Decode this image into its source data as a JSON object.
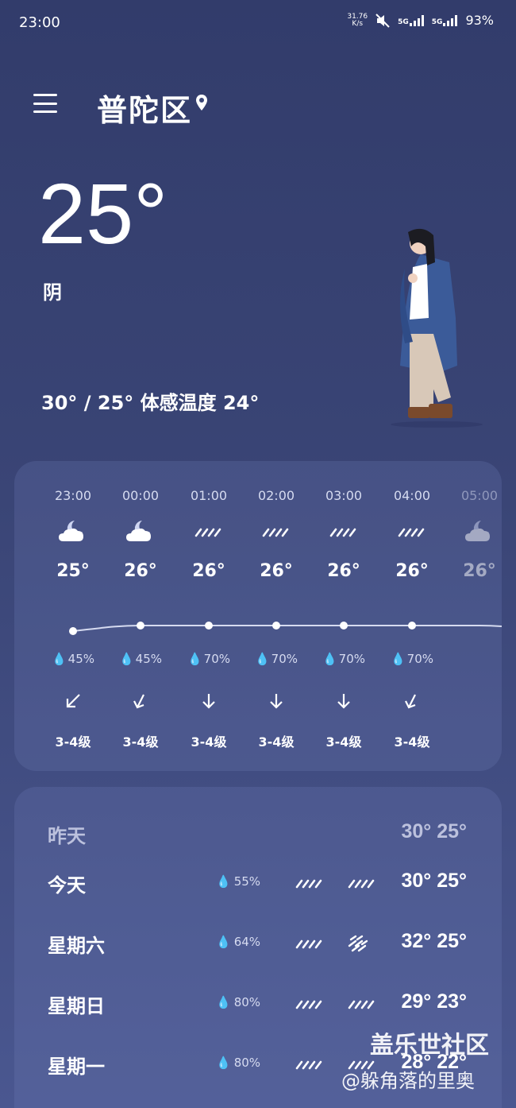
{
  "status": {
    "time": "23:00",
    "speed_value": "31.76",
    "speed_unit": "K/s",
    "net1": "5G",
    "net2": "5G",
    "battery": "93%"
  },
  "header": {
    "city": "普陀区",
    "menu_icon": "menu-icon",
    "location_icon": "location-pin-icon"
  },
  "current": {
    "temp": "25°",
    "condition": "阴",
    "range": "30° / 25° 体感温度 24°"
  },
  "hourly": [
    {
      "time": "23:00",
      "icon": "moon-cloud-icon",
      "temp": "25°",
      "humidity": "45%",
      "wind": "3-4级"
    },
    {
      "time": "00:00",
      "icon": "moon-cloud-icon",
      "temp": "26°",
      "humidity": "45%",
      "wind": "3-4级"
    },
    {
      "time": "01:00",
      "icon": "rain-icon",
      "temp": "26°",
      "humidity": "70%",
      "wind": "3-4级"
    },
    {
      "time": "02:00",
      "icon": "rain-icon",
      "temp": "26°",
      "humidity": "70%",
      "wind": "3-4级"
    },
    {
      "time": "03:00",
      "icon": "rain-icon",
      "temp": "26°",
      "humidity": "70%",
      "wind": "3-4级"
    },
    {
      "time": "04:00",
      "icon": "rain-icon",
      "temp": "26°",
      "humidity": "70%",
      "wind": "3-4级"
    },
    {
      "time": "05:00",
      "icon": "moon-cloud-icon",
      "temp": "26°",
      "humidity": "",
      "wind": ""
    }
  ],
  "daily": [
    {
      "day": "昨天",
      "humidity": "",
      "temp": "30° 25°"
    },
    {
      "day": "今天",
      "humidity": "55%",
      "temp": "30° 25°"
    },
    {
      "day": "星期六",
      "humidity": "64%",
      "temp": "32° 25°"
    },
    {
      "day": "星期日",
      "humidity": "80%",
      "temp": "29° 23°"
    },
    {
      "day": "星期一",
      "humidity": "80%",
      "temp": "28° 22°"
    }
  ],
  "watermark": {
    "line1": "盖乐世社区",
    "line2": "@躲角落的里奥"
  },
  "colors": {
    "background_top": "#323c6b",
    "background_bottom": "#4a5790",
    "card": "#5a6396"
  }
}
